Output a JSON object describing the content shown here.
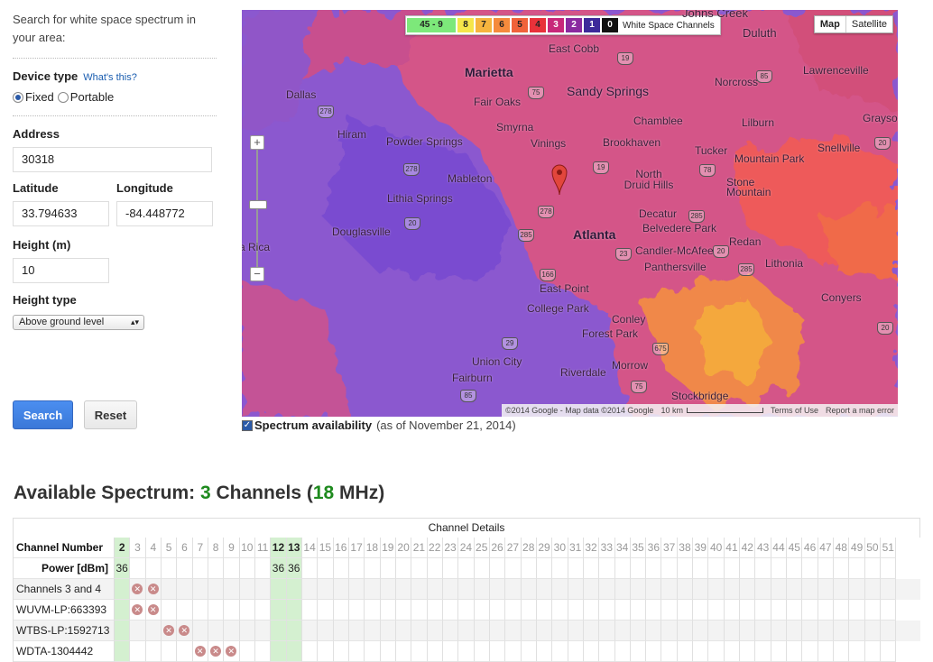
{
  "left": {
    "intro": "Search for white space spectrum in your area:",
    "device_type_label": "Device type",
    "whats_this": "What's this?",
    "fixed": "Fixed",
    "portable": "Portable",
    "address_label": "Address",
    "address_value": "30318",
    "latitude_label": "Latitude",
    "latitude_value": "33.794633",
    "longitude_label": "Longitude",
    "longitude_value": "-84.448772",
    "height_label": "Height (m)",
    "height_value": "10",
    "height_type_label": "Height type",
    "height_type_value": "Above ground level",
    "search": "Search",
    "reset": "Reset"
  },
  "map": {
    "legend": [
      {
        "label": "45 - 9",
        "color": "#7de87a",
        "text": "#222"
      },
      {
        "label": "8",
        "color": "#f5e64a",
        "text": "#222"
      },
      {
        "label": "7",
        "color": "#f6b43e",
        "text": "#222"
      },
      {
        "label": "6",
        "color": "#f58a3c",
        "text": "#222"
      },
      {
        "label": "5",
        "color": "#f0623a",
        "text": "#222"
      },
      {
        "label": "4",
        "color": "#e8323a",
        "text": "#222"
      },
      {
        "label": "3",
        "color": "#c8287a",
        "text": "#fff"
      },
      {
        "label": "2",
        "color": "#8a2aa0",
        "text": "#fff"
      },
      {
        "label": "1",
        "color": "#3c2a9a",
        "text": "#fff"
      },
      {
        "label": "0",
        "color": "#111111",
        "text": "#fff"
      }
    ],
    "legend_title": "White Space Channels",
    "map_btn": "Map",
    "satellite_btn": "Satellite",
    "places": {
      "johns_creek": "Johns Creek",
      "duluth": "Duluth",
      "east_cobb": "East Cobb",
      "marietta": "Marietta",
      "lawrenceville": "Lawrenceville",
      "sandy_springs": "Sandy Springs",
      "norcross": "Norcross",
      "dallas": "Dallas",
      "fair_oaks": "Fair Oaks",
      "chamblee": "Chamblee",
      "lilburn": "Lilburn",
      "grayson": "Grayso",
      "hiram": "Hiram",
      "smyrna": "Smyrna",
      "powder_springs": "Powder\nSprings",
      "vinings": "Vinings",
      "brookhaven": "Brookhaven",
      "tucker": "Tucker",
      "snellville": "Snellville",
      "mountain_park": "Mountain Park",
      "mableton": "Mableton",
      "north_druid_hills": "North\nDruid Hills",
      "stone_mountain": "Stone\nMountain",
      "lithia_springs": "Lithia Springs",
      "decatur": "Decatur",
      "belvedere_park": "Belvedere Park",
      "douglasville": "Douglasville",
      "atlanta": "Atlanta",
      "redan": "Redan",
      "candler_mcafee": "Candler-McAfee",
      "panthersville": "Panthersville",
      "lithonia": "Lithonia",
      "villa_rica": "a Rica",
      "east_point": "East Point",
      "conyers": "Conyers",
      "college_park": "College Park",
      "conley": "Conley",
      "forest_park": "Forest Park",
      "union_city": "Union City",
      "morrow": "Morrow",
      "riverdale": "Riverdale",
      "fairburn": "Fairburn",
      "stockbridge": "Stockbridge"
    },
    "shields": {
      "s19a": "19",
      "s75a": "75",
      "s85a": "85",
      "s278a": "278",
      "s278b": "278",
      "s19b": "19",
      "s78": "78",
      "s20a": "20",
      "s278c": "278",
      "s285a": "285",
      "s285b": "285",
      "s20b": "20",
      "s166": "166",
      "s23": "23",
      "s285c": "285",
      "s29": "29",
      "s675": "675",
      "s20c": "20",
      "s85b": "85",
      "s75b": "75",
      "s20d": "20"
    },
    "attribution": "©2014 Google - Map data ©2014 Google",
    "scale": "10 km",
    "terms": "Terms of Use",
    "report": "Report a map error"
  },
  "availability": {
    "label": "Spectrum availability",
    "asof": "(as of November 21, 2014)"
  },
  "spectrum": {
    "heading_prefix": "Available Spectrum: ",
    "count": "3",
    "channels_word": " Channels (",
    "mhz": "18",
    "mhz_suffix": " MHz)",
    "table_title": "Channel Details",
    "channel_number_label": "Channel Number",
    "power_label": "Power [dBm]",
    "channels": [
      2,
      3,
      4,
      5,
      6,
      7,
      8,
      9,
      10,
      11,
      12,
      13,
      14,
      15,
      16,
      17,
      18,
      19,
      20,
      21,
      22,
      23,
      24,
      25,
      26,
      27,
      28,
      29,
      30,
      31,
      32,
      33,
      34,
      35,
      36,
      37,
      38,
      39,
      40,
      41,
      42,
      43,
      44,
      45,
      46,
      47,
      48,
      49,
      50,
      51
    ],
    "available": [
      2,
      12,
      13
    ],
    "power": {
      "2": "36",
      "12": "36",
      "13": "36"
    },
    "rows": [
      {
        "label": "Channels 3 and 4",
        "blocked": [
          3,
          4
        ]
      },
      {
        "label": "WUVM-LP:663393",
        "blocked": [
          3,
          4
        ]
      },
      {
        "label": "WTBS-LP:1592713",
        "blocked": [
          5,
          6
        ]
      },
      {
        "label": "WDTA-1304442",
        "blocked": [
          7,
          8,
          9
        ]
      }
    ]
  }
}
